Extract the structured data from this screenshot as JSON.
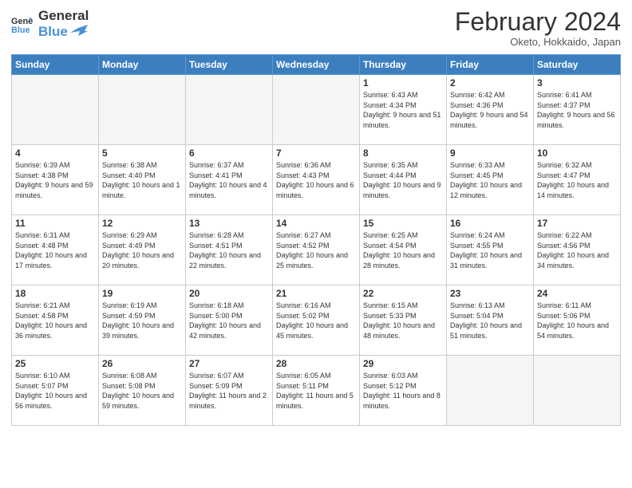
{
  "header": {
    "logo_line1": "General",
    "logo_line2": "Blue",
    "month_title": "February 2024",
    "location": "Oketo, Hokkaido, Japan"
  },
  "days_of_week": [
    "Sunday",
    "Monday",
    "Tuesday",
    "Wednesday",
    "Thursday",
    "Friday",
    "Saturday"
  ],
  "weeks": [
    [
      {
        "day": "",
        "info": ""
      },
      {
        "day": "",
        "info": ""
      },
      {
        "day": "",
        "info": ""
      },
      {
        "day": "",
        "info": ""
      },
      {
        "day": "1",
        "info": "Sunrise: 6:43 AM\nSunset: 4:34 PM\nDaylight: 9 hours and 51 minutes."
      },
      {
        "day": "2",
        "info": "Sunrise: 6:42 AM\nSunset: 4:36 PM\nDaylight: 9 hours and 54 minutes."
      },
      {
        "day": "3",
        "info": "Sunrise: 6:41 AM\nSunset: 4:37 PM\nDaylight: 9 hours and 56 minutes."
      }
    ],
    [
      {
        "day": "4",
        "info": "Sunrise: 6:39 AM\nSunset: 4:38 PM\nDaylight: 9 hours and 59 minutes."
      },
      {
        "day": "5",
        "info": "Sunrise: 6:38 AM\nSunset: 4:40 PM\nDaylight: 10 hours and 1 minute."
      },
      {
        "day": "6",
        "info": "Sunrise: 6:37 AM\nSunset: 4:41 PM\nDaylight: 10 hours and 4 minutes."
      },
      {
        "day": "7",
        "info": "Sunrise: 6:36 AM\nSunset: 4:43 PM\nDaylight: 10 hours and 6 minutes."
      },
      {
        "day": "8",
        "info": "Sunrise: 6:35 AM\nSunset: 4:44 PM\nDaylight: 10 hours and 9 minutes."
      },
      {
        "day": "9",
        "info": "Sunrise: 6:33 AM\nSunset: 4:45 PM\nDaylight: 10 hours and 12 minutes."
      },
      {
        "day": "10",
        "info": "Sunrise: 6:32 AM\nSunset: 4:47 PM\nDaylight: 10 hours and 14 minutes."
      }
    ],
    [
      {
        "day": "11",
        "info": "Sunrise: 6:31 AM\nSunset: 4:48 PM\nDaylight: 10 hours and 17 minutes."
      },
      {
        "day": "12",
        "info": "Sunrise: 6:29 AM\nSunset: 4:49 PM\nDaylight: 10 hours and 20 minutes."
      },
      {
        "day": "13",
        "info": "Sunrise: 6:28 AM\nSunset: 4:51 PM\nDaylight: 10 hours and 22 minutes."
      },
      {
        "day": "14",
        "info": "Sunrise: 6:27 AM\nSunset: 4:52 PM\nDaylight: 10 hours and 25 minutes."
      },
      {
        "day": "15",
        "info": "Sunrise: 6:25 AM\nSunset: 4:54 PM\nDaylight: 10 hours and 28 minutes."
      },
      {
        "day": "16",
        "info": "Sunrise: 6:24 AM\nSunset: 4:55 PM\nDaylight: 10 hours and 31 minutes."
      },
      {
        "day": "17",
        "info": "Sunrise: 6:22 AM\nSunset: 4:56 PM\nDaylight: 10 hours and 34 minutes."
      }
    ],
    [
      {
        "day": "18",
        "info": "Sunrise: 6:21 AM\nSunset: 4:58 PM\nDaylight: 10 hours and 36 minutes."
      },
      {
        "day": "19",
        "info": "Sunrise: 6:19 AM\nSunset: 4:59 PM\nDaylight: 10 hours and 39 minutes."
      },
      {
        "day": "20",
        "info": "Sunrise: 6:18 AM\nSunset: 5:00 PM\nDaylight: 10 hours and 42 minutes."
      },
      {
        "day": "21",
        "info": "Sunrise: 6:16 AM\nSunset: 5:02 PM\nDaylight: 10 hours and 45 minutes."
      },
      {
        "day": "22",
        "info": "Sunrise: 6:15 AM\nSunset: 5:33 PM\nDaylight: 10 hours and 48 minutes."
      },
      {
        "day": "23",
        "info": "Sunrise: 6:13 AM\nSunset: 5:04 PM\nDaylight: 10 hours and 51 minutes."
      },
      {
        "day": "24",
        "info": "Sunrise: 6:11 AM\nSunset: 5:06 PM\nDaylight: 10 hours and 54 minutes."
      }
    ],
    [
      {
        "day": "25",
        "info": "Sunrise: 6:10 AM\nSunset: 5:07 PM\nDaylight: 10 hours and 56 minutes."
      },
      {
        "day": "26",
        "info": "Sunrise: 6:08 AM\nSunset: 5:08 PM\nDaylight: 10 hours and 59 minutes."
      },
      {
        "day": "27",
        "info": "Sunrise: 6:07 AM\nSunset: 5:09 PM\nDaylight: 11 hours and 2 minutes."
      },
      {
        "day": "28",
        "info": "Sunrise: 6:05 AM\nSunset: 5:11 PM\nDaylight: 11 hours and 5 minutes."
      },
      {
        "day": "29",
        "info": "Sunrise: 6:03 AM\nSunset: 5:12 PM\nDaylight: 11 hours and 8 minutes."
      },
      {
        "day": "",
        "info": ""
      },
      {
        "day": "",
        "info": ""
      }
    ]
  ]
}
